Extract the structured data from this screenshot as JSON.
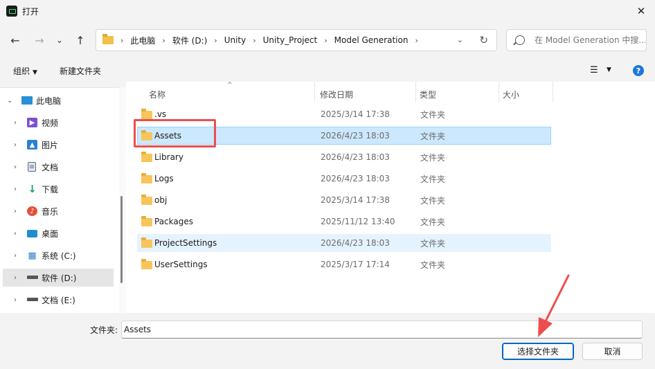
{
  "window": {
    "title": "打开",
    "close_glyph": "✕"
  },
  "nav": {
    "back_glyph": "←",
    "forward_glyph": "→",
    "recent_glyph": "⌄",
    "up_glyph": "↑",
    "breadcrumbs": [
      "此电脑",
      "软件 (D:)",
      "Unity",
      "Unity_Project",
      "Model Generation"
    ],
    "sep_glyph": "›",
    "dropdown_glyph": "⌄",
    "refresh_glyph": "↻",
    "search_placeholder": "在 Model Generation 中搜..."
  },
  "commands": {
    "organize_label": "组织",
    "new_folder_label": "新建文件夹",
    "caret_glyph": "▼",
    "view_glyph": "☰",
    "help_glyph": "?"
  },
  "sidebar": {
    "items": [
      {
        "label": "此电脑",
        "arrow": "⌄",
        "icon": "computer-icon",
        "color": "#2a8fd8"
      },
      {
        "label": "视频",
        "arrow": "›",
        "icon": "video-icon",
        "color": "#7b4fd1"
      },
      {
        "label": "图片",
        "arrow": "›",
        "icon": "pictures-icon",
        "color": "#2b7fd4"
      },
      {
        "label": "文档",
        "arrow": "›",
        "icon": "documents-icon",
        "color": "#5b6a7a"
      },
      {
        "label": "下载",
        "arrow": "›",
        "icon": "downloads-icon",
        "color": "#1e9f6e"
      },
      {
        "label": "音乐",
        "arrow": "›",
        "icon": "music-icon",
        "color": "#e2523b"
      },
      {
        "label": "桌面",
        "arrow": "›",
        "icon": "desktop-icon",
        "color": "#1d8fcf"
      },
      {
        "label": "系统 (C:)",
        "arrow": "›",
        "icon": "windows-drive-icon",
        "color": "#2a7fd0"
      },
      {
        "label": "软件 (D:)",
        "arrow": "›",
        "icon": "drive-icon",
        "color": "#555555"
      },
      {
        "label": "文档 (E:)",
        "arrow": "›",
        "icon": "drive-icon",
        "color": "#555555"
      }
    ]
  },
  "columns": {
    "name": "名称",
    "modified": "修改日期",
    "type": "类型",
    "size": "大小",
    "sort_glyph": "^"
  },
  "files": [
    {
      "name": ".vs",
      "modified": "2025/3/14 17:38",
      "type": "文件夹"
    },
    {
      "name": "Assets",
      "modified": "2026/4/23 18:03",
      "type": "文件夹"
    },
    {
      "name": "Library",
      "modified": "2026/4/23 18:03",
      "type": "文件夹"
    },
    {
      "name": "Logs",
      "modified": "2026/4/23 18:03",
      "type": "文件夹"
    },
    {
      "name": "obj",
      "modified": "2025/3/14 17:38",
      "type": "文件夹"
    },
    {
      "name": "Packages",
      "modified": "2025/11/12 13:40",
      "type": "文件夹"
    },
    {
      "name": "ProjectSettings",
      "modified": "2026/4/23 18:03",
      "type": "文件夹"
    },
    {
      "name": "UserSettings",
      "modified": "2025/3/17 17:14",
      "type": "文件夹"
    }
  ],
  "footer": {
    "folder_label": "文件夹:",
    "folder_value": "Assets",
    "select_button": "选择文件夹",
    "cancel_button": "取消"
  },
  "colors": {
    "selection": "#cce8ff",
    "annotation": "#ee4d4d",
    "accent": "#0067c0"
  }
}
